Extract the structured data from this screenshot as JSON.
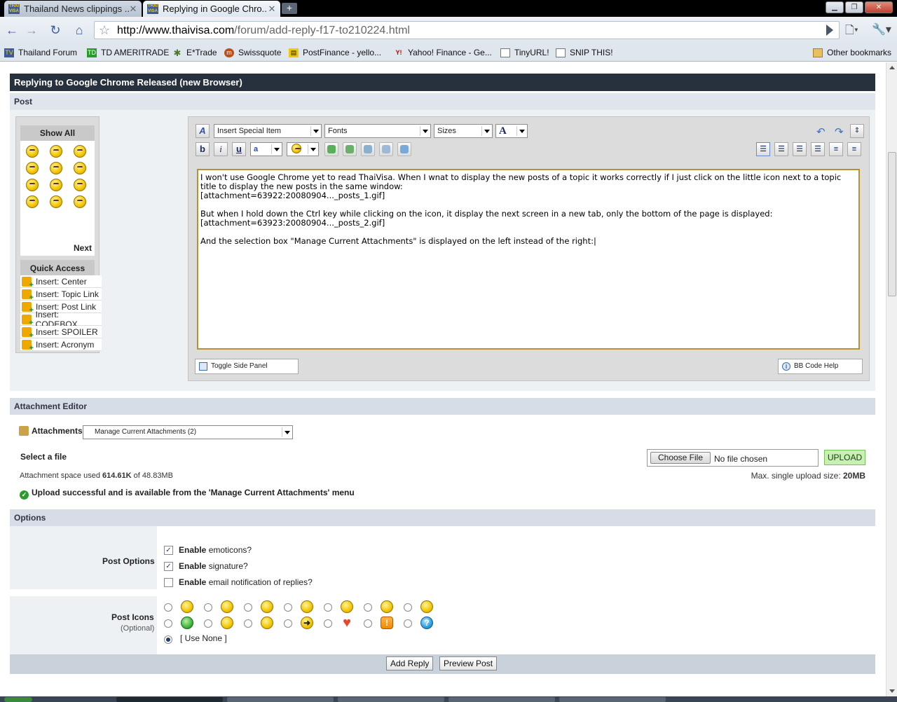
{
  "browser": {
    "tabs": [
      {
        "label": "Thailand News clippings ...",
        "favicon": "THAI VISA"
      },
      {
        "label": "Replying in Google Chro...",
        "favicon": "THAI VISA"
      }
    ],
    "url_domain": "http://www.thaivisa.com",
    "url_path": "/forum/add-reply-f17-to210224.html",
    "bookmarks": [
      {
        "label": "Thailand Forum",
        "icon": "thaivisa-icon"
      },
      {
        "label": "TD AMERITRADE",
        "icon": "td-icon"
      },
      {
        "label": "E*Trade",
        "icon": "etrade-icon"
      },
      {
        "label": "Swissquote",
        "icon": "swissquote-icon"
      },
      {
        "label": "PostFinance - yello...",
        "icon": "postfinance-icon"
      },
      {
        "label": "Yahoo! Finance - Ge...",
        "icon": "yahoo-icon"
      },
      {
        "label": "TinyURL!",
        "icon": "page-icon"
      },
      {
        "label": "SNIP THIS!",
        "icon": "page-icon"
      }
    ],
    "other_bookmarks": "Other bookmarks"
  },
  "page": {
    "title": "Replying to Google Chrome Released (new Browser)",
    "post_section": "Post",
    "side_panel": {
      "show_all": "Show All",
      "next": "Next",
      "quick_access": "Quick Access",
      "items": [
        "Insert: Center",
        "Insert: Topic Link",
        "Insert: Post Link",
        "Insert: CODEBOX",
        "Insert: SPOILER",
        "Insert: Acronym"
      ]
    },
    "editor": {
      "special_item": "Insert Special Item",
      "fonts": "Fonts",
      "sizes": "Sizes",
      "color_label": "A",
      "bold": "b",
      "italic": "i",
      "underline": "u",
      "body": "I won't use Google Chrome yet to read ThaiVisa. When I wnat to display the new posts of a topic it works correctly if I just click on the little icon next to a topic title to display the new posts in the same window:\n[attachment=63922:20080904..._posts_1.gif]\n\nBut when I hold down the Ctrl key while clicking on the icon, it display the next screen in a new tab, only the bottom of the page is displayed:\n[attachment=63923:20080904..._posts_2.gif]\n\nAnd the selection box \"Manage Current Attachments\" is displayed on the left instead of the right:|",
      "toggle_side_panel": "Toggle Side Panel",
      "bb_code_help": "BB Code Help"
    },
    "attachments": {
      "header": "Attachment Editor",
      "label": "Attachments",
      "select_value": "Manage Current Attachments (2)",
      "select_file": "Select a file",
      "choose_file": "Choose File",
      "no_file": "No file chosen",
      "upload": "UPLOAD",
      "space_prefix": "Attachment space used ",
      "space_used": "614.61K",
      "space_of": " of ",
      "space_total": "48.83MB",
      "max_prefix": "Max. single upload size: ",
      "max_size": "20MB",
      "success": "Upload successful and is available from the 'Manage Current Attachments' menu"
    },
    "options": {
      "header": "Options",
      "post_options_label": "Post Options",
      "opts": [
        {
          "bold": "Enable",
          "rest": " emoticons?",
          "checked": true
        },
        {
          "bold": "Enable",
          "rest": " signature?",
          "checked": true
        },
        {
          "bold": "Enable",
          "rest": " email notification of replies?",
          "checked": false
        }
      ],
      "post_icons_label": "Post Icons",
      "post_icons_sub": "(Optional)",
      "use_none": "[ Use None ]"
    },
    "buttons": {
      "add_reply": "Add Reply",
      "preview_post": "Preview Post"
    }
  }
}
